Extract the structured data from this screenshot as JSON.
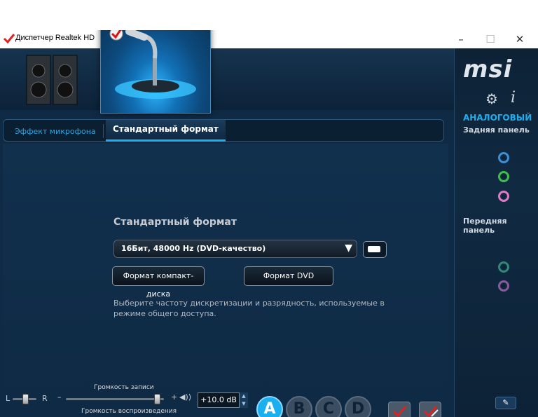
{
  "window": {
    "title": "Диспетчер Realtek HD",
    "controls": {
      "minimize": "–",
      "maximize": "☐",
      "close": "✕"
    }
  },
  "brand": {
    "logo_text": "msi"
  },
  "right_panel": {
    "mode_label": "АНАЛОГОВЫЙ",
    "rear_label": "Задняя панель",
    "front_label": "Передняя панель",
    "rear_jacks": [
      {
        "name": "line-in",
        "color": "#3b8fd6"
      },
      {
        "name": "line-out",
        "color": "#3fbf4a"
      },
      {
        "name": "mic-in",
        "color": "#e07ac8"
      }
    ],
    "front_jacks": [
      {
        "name": "headphone",
        "color": "#2f8a7a"
      },
      {
        "name": "mic",
        "color": "#8a5a9a"
      }
    ],
    "gear_icon": "⚙",
    "info_icon": "i",
    "wrench_icon": "🔧"
  },
  "tabs": {
    "effect": "Эффект микрофона",
    "format": "Стандартный формат"
  },
  "main": {
    "section_title": "Стандартный формат",
    "format_select_value": "16Бит, 48000 Hz (DVD-качество)",
    "cd_button": "Формат компакт-диска",
    "dvd_button": "Формат DVD",
    "description": "Выберите частоту дискретизации и разрядность, используемые в режиме общего доступа."
  },
  "volume": {
    "record_label": "Громкость записи",
    "playback_label": "Громкость воспроизведения",
    "left": "L",
    "right": "R",
    "minus": "–",
    "plus": "+",
    "record_level": 0.95,
    "playback_level": 0.0,
    "db_value": "+10.0 dB"
  },
  "letter_buttons": [
    "A",
    "B",
    "C",
    "D"
  ],
  "accent_color": "#1ab0f0"
}
